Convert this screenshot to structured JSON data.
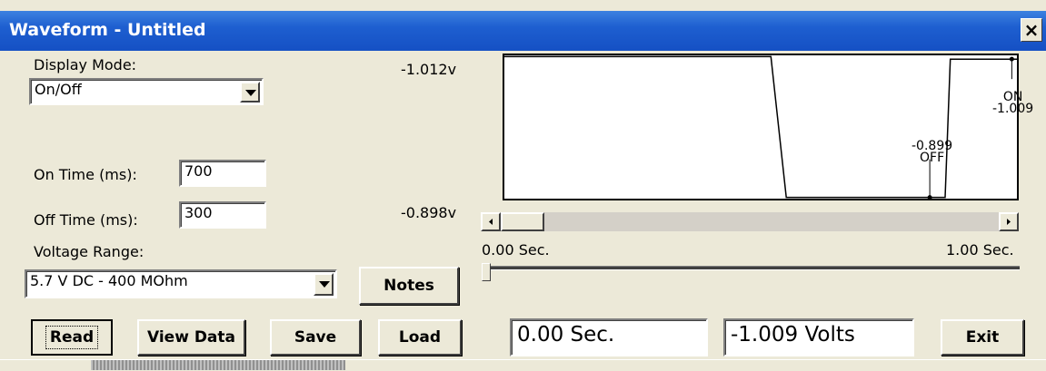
{
  "window": {
    "title": "Waveform - Untitled",
    "close_glyph": "×"
  },
  "controls": {
    "display_mode_label": "Display Mode:",
    "display_mode_value": "On/Off",
    "on_time_label": "On Time (ms):",
    "on_time_value": "700",
    "off_time_label": "Off Time (ms):",
    "off_time_value": "300",
    "voltage_range_label": "Voltage Range:",
    "voltage_range_value": "5.7 V DC - 400 MOhm"
  },
  "buttons": {
    "notes": "Notes",
    "read": "Read",
    "view_data": "View Data",
    "save": "Save",
    "load": "Load",
    "exit": "Exit"
  },
  "plot": {
    "y_top_label": "-1.012v",
    "y_bottom_label": "-0.898v",
    "x_start_label": "0.00 Sec.",
    "x_end_label": "1.00 Sec.",
    "annotations": {
      "on_state": "ON",
      "on_value": "-1.009",
      "off_value": "-0.899",
      "off_state": "OFF"
    }
  },
  "readouts": {
    "time": "0.00 Sec.",
    "voltage": "-1.009 Volts"
  },
  "chart_data": {
    "type": "line",
    "x": [
      0.0,
      0.52,
      0.55,
      0.83,
      0.86,
      0.87,
      1.0
    ],
    "y": [
      -1.011,
      -1.011,
      -0.899,
      -0.899,
      -0.899,
      -1.009,
      -1.009
    ],
    "ylim": [
      -1.012,
      -0.898
    ],
    "xlim": [
      0.0,
      1.0
    ],
    "markers": [
      {
        "x": 0.83,
        "y": -0.899,
        "label": "OFF"
      },
      {
        "x": 0.99,
        "y": -1.009,
        "label": "ON"
      }
    ]
  },
  "colors": {
    "title_bar": "#1e5fd0",
    "window_bg": "#ece9d8"
  }
}
